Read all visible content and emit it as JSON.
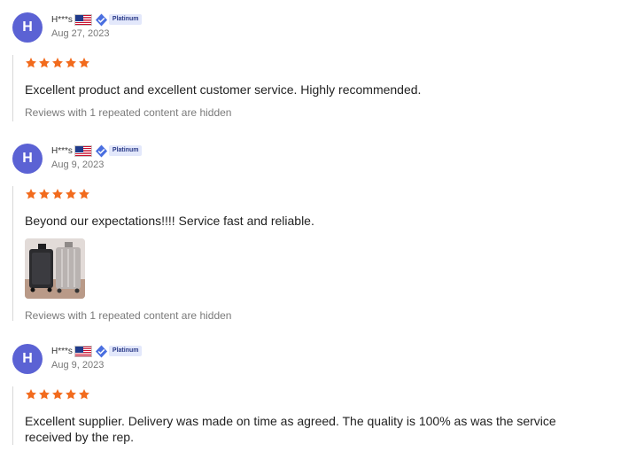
{
  "reviews": [
    {
      "avatar_letter": "H",
      "username": "H***s",
      "country_flag_icon": "us-flag-icon",
      "badge_icon": "diamond-icon",
      "badge": "Platinum",
      "date": "Aug 27, 2023",
      "rating": 5,
      "text": "Excellent product and excellent customer service. Highly recommended.",
      "photos": [],
      "hidden_note": "Reviews with 1 repeated content are hidden"
    },
    {
      "avatar_letter": "H",
      "username": "H***s",
      "country_flag_icon": "us-flag-icon",
      "badge_icon": "diamond-icon",
      "badge": "Platinum",
      "date": "Aug 9, 2023",
      "rating": 5,
      "text": "Beyond our expectations!!!! Service fast and reliable.",
      "photos": [
        "luggage-photo"
      ],
      "hidden_note": "Reviews with 1 repeated content are hidden"
    },
    {
      "avatar_letter": "H",
      "username": "H***s",
      "country_flag_icon": "us-flag-icon",
      "badge_icon": "diamond-icon",
      "badge": "Platinum",
      "date": "Aug 9, 2023",
      "rating": 5,
      "text": "Excellent supplier. Delivery was made on time as agreed. The quality is 100% as was the service received by the rep.",
      "photos": [],
      "hidden_note": ""
    }
  ],
  "colors": {
    "avatar": "#5b62d4",
    "star": "#f26b1d",
    "badge_bg": "#e3e8fb",
    "badge_text": "#2a3a88"
  }
}
